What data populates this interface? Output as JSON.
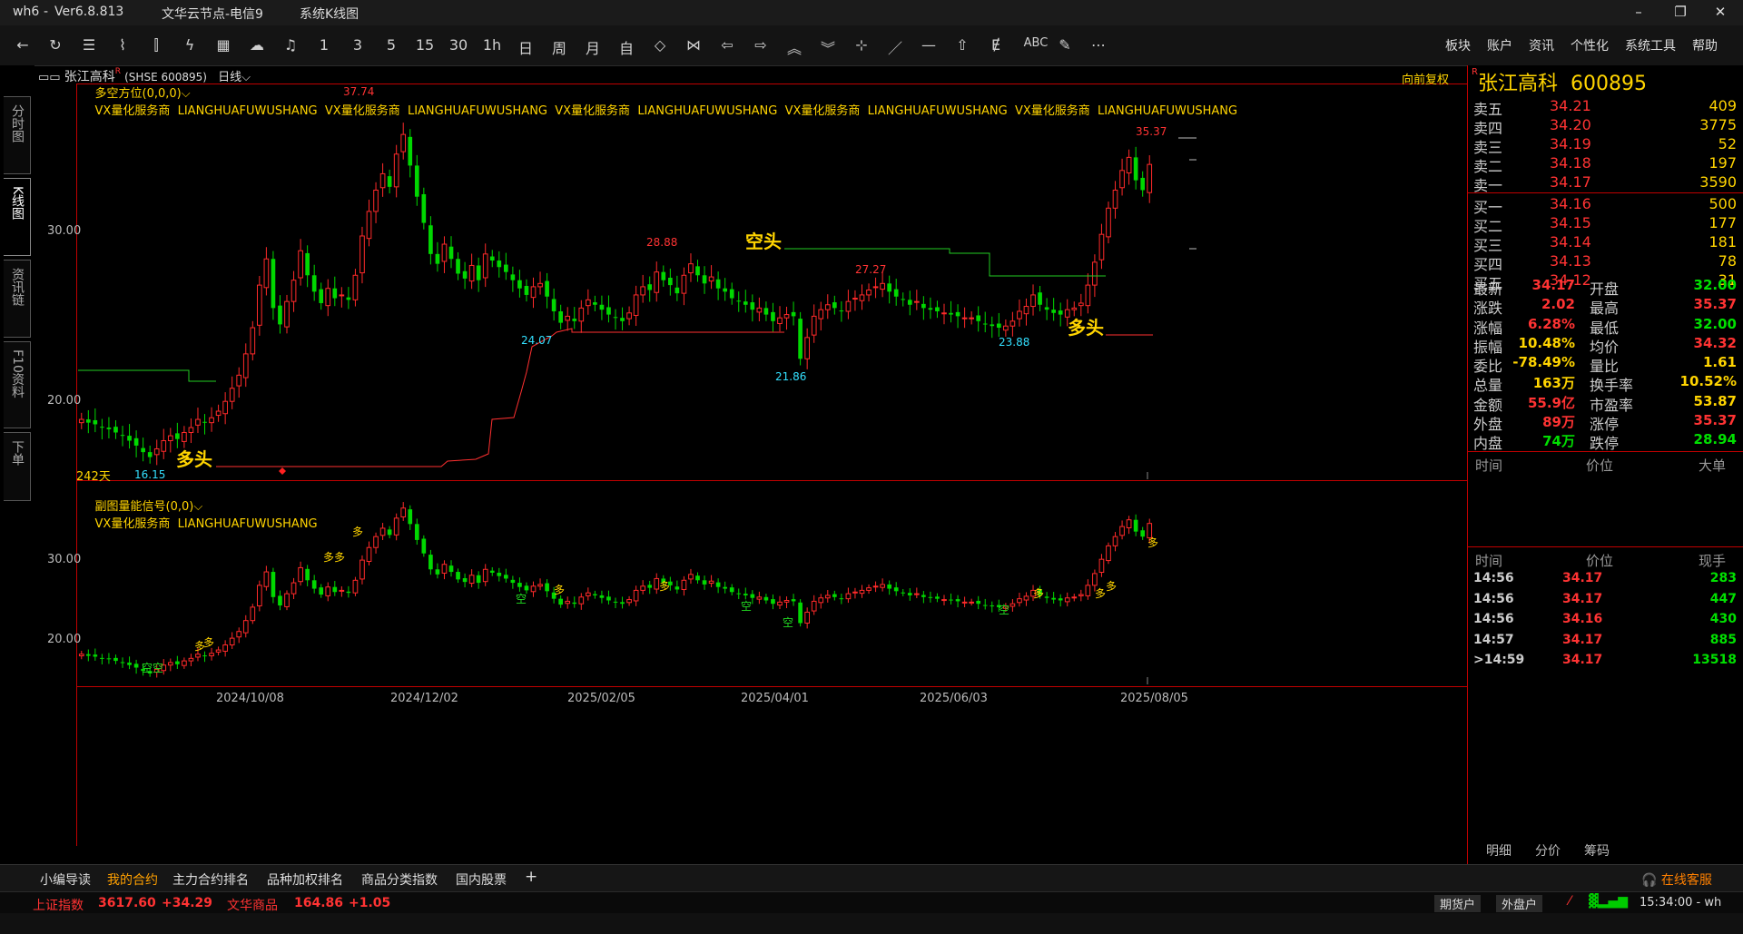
{
  "window": {
    "app": "wh6",
    "version": "Ver6.8.813",
    "node": "文华云节点-电信9",
    "mode": "系统K线图"
  },
  "toolbar": {
    "periods": [
      "1",
      "3",
      "5",
      "15",
      "30",
      "1h",
      "日",
      "周",
      "月",
      "自"
    ],
    "menus": [
      "板块",
      "账户",
      "资讯",
      "个性化",
      "系统工具",
      "帮助"
    ],
    "abc": "ABC"
  },
  "left_tabs": [
    "分时图",
    "K线图",
    "资讯链",
    "F10资料",
    "下单"
  ],
  "chart": {
    "symbol_header": "张江高科",
    "symbol_code": "(SHSE 600895)",
    "period": "日线",
    "main_indicator": "多空方位(0,0,0)",
    "main_tags": "VX量化服务商  LIANGHUAFUWUSHANG  VX量化服务商  LIANGHUAFUWUSHANG  VX量化服务商  LIANGHUAFUWUSHANG  VX量化服务商  LIANGHUAFUWUSHANG  VX量化服务商  LIANGHUAFUWUSHANG",
    "adjust": "向前复权",
    "sub_indicator": "副图量能信号(0,0)",
    "sub_tags": "VX量化服务商  LIANGHUAFUWUSHANG",
    "days_label": "242天",
    "annotations": {
      "duo1": "多头",
      "kong": "空头",
      "duo2": "多头"
    },
    "price_labels": [
      "37.74",
      "28.88",
      "27.27",
      "35.37",
      "24.07",
      "21.86",
      "23.88",
      "16.15"
    ],
    "y_labels_main": [
      "30.00",
      "20.00"
    ],
    "y_labels_sub": [
      "30.00",
      "20.00"
    ],
    "x_labels": [
      "2024/10/08",
      "2024/12/02",
      "2025/02/05",
      "2025/04/01",
      "2025/06/03",
      "2025/08/05"
    ],
    "signal_duo": "多",
    "signal_kong": "空"
  },
  "chart_data": {
    "type": "candlestick",
    "y_main": [
      15,
      39
    ],
    "y_sub": [
      15,
      39
    ],
    "closes": [
      18.6,
      18.4,
      18.3,
      18.1,
      18.0,
      17.8,
      17.6,
      17.3,
      17.0,
      16.6,
      16.3,
      16.8,
      17.3,
      17.6,
      17.4,
      17.8,
      18.1,
      18.6,
      18.4,
      18.7,
      19.1,
      19.7,
      20.5,
      21.3,
      22.6,
      24.2,
      26.8,
      28.4,
      25.4,
      24.4,
      25.8,
      27.1,
      28.9,
      27.4,
      26.4,
      25.7,
      26.6,
      26.0,
      26.2,
      25.9,
      27.4,
      29.8,
      31.3,
      32.6,
      33.6,
      32.8,
      34.8,
      36.0,
      34.1,
      32.2,
      30.6,
      28.7,
      28.1,
      29.3,
      28.4,
      27.5,
      27.2,
      28.0,
      27.1,
      28.7,
      28.3,
      27.9,
      27.6,
      27.1,
      26.6,
      26.2,
      26.7,
      26.9,
      26.1,
      25.2,
      24.5,
      24.9,
      24.6,
      25.4,
      25.9,
      25.6,
      25.3,
      25.0,
      24.8,
      24.6,
      25.1,
      26.2,
      26.7,
      26.5,
      27.6,
      27.1,
      26.8,
      26.3,
      27.4,
      28.1,
      27.4,
      26.9,
      27.3,
      26.6,
      26.4,
      26.0,
      25.8,
      25.6,
      25.3,
      25.4,
      25.0,
      24.6,
      24.8,
      25.0,
      24.9,
      22.3,
      23.6,
      24.9,
      25.3,
      25.6,
      25.4,
      25.2,
      25.8,
      26.0,
      26.2,
      26.5,
      26.7,
      26.9,
      26.4,
      26.1,
      25.9,
      25.6,
      25.8,
      25.4,
      25.3,
      25.2,
      25.1,
      25.0,
      24.9,
      24.8,
      24.8,
      24.6,
      24.4,
      24.3,
      24.2,
      24.3,
      24.6,
      25.2,
      25.5,
      26.2,
      25.6,
      25.3,
      25.1,
      25.0,
      25.3,
      25.4,
      25.7,
      26.8,
      28.2,
      29.9,
      31.5,
      32.6,
      33.8,
      34.6,
      33.2,
      32.6,
      34.17
    ]
  }
}
